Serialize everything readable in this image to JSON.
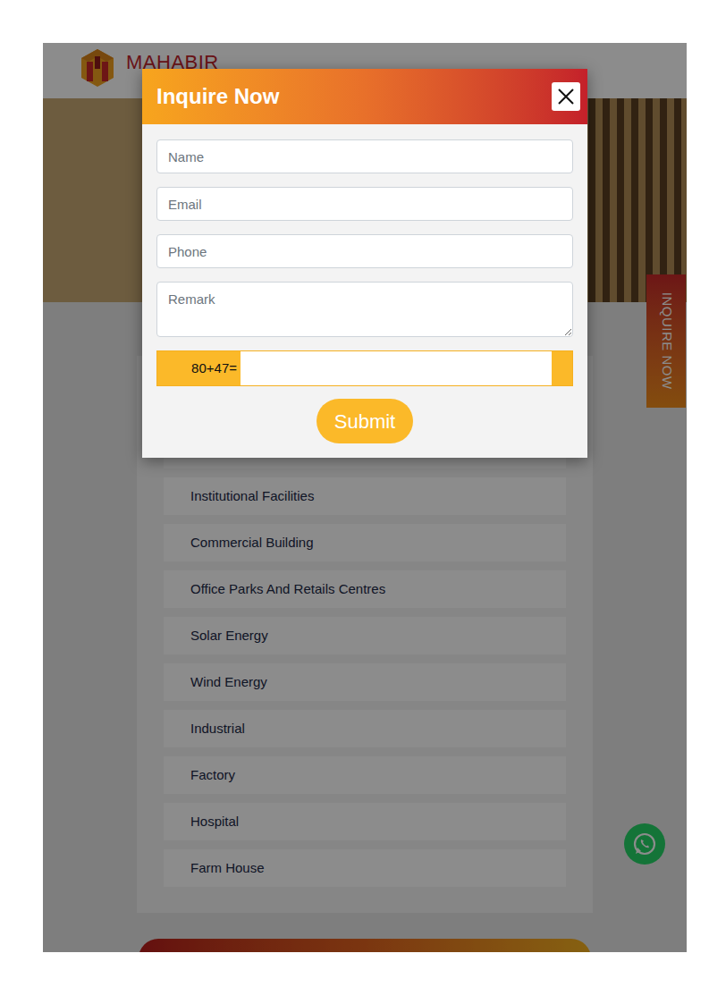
{
  "header": {
    "logo": "MAHABIR"
  },
  "services": [
    "Institutional Facilities",
    "Commercial Building",
    "Office Parks And Retails Centres",
    "Solar Energy",
    "Wind Energy",
    "Industrial",
    "Factory",
    "Hospital",
    "Farm House"
  ],
  "side_tab": "INQUIRE NOW",
  "modal": {
    "title": "Inquire Now",
    "fields": [
      {
        "placeholder": "Name",
        "kind": "input"
      },
      {
        "placeholder": "Email",
        "kind": "input"
      },
      {
        "placeholder": "Phone",
        "kind": "input"
      },
      {
        "placeholder": "Remark",
        "kind": "textarea"
      }
    ],
    "captcha": {
      "question": "80+47="
    },
    "submit": "Submit"
  }
}
